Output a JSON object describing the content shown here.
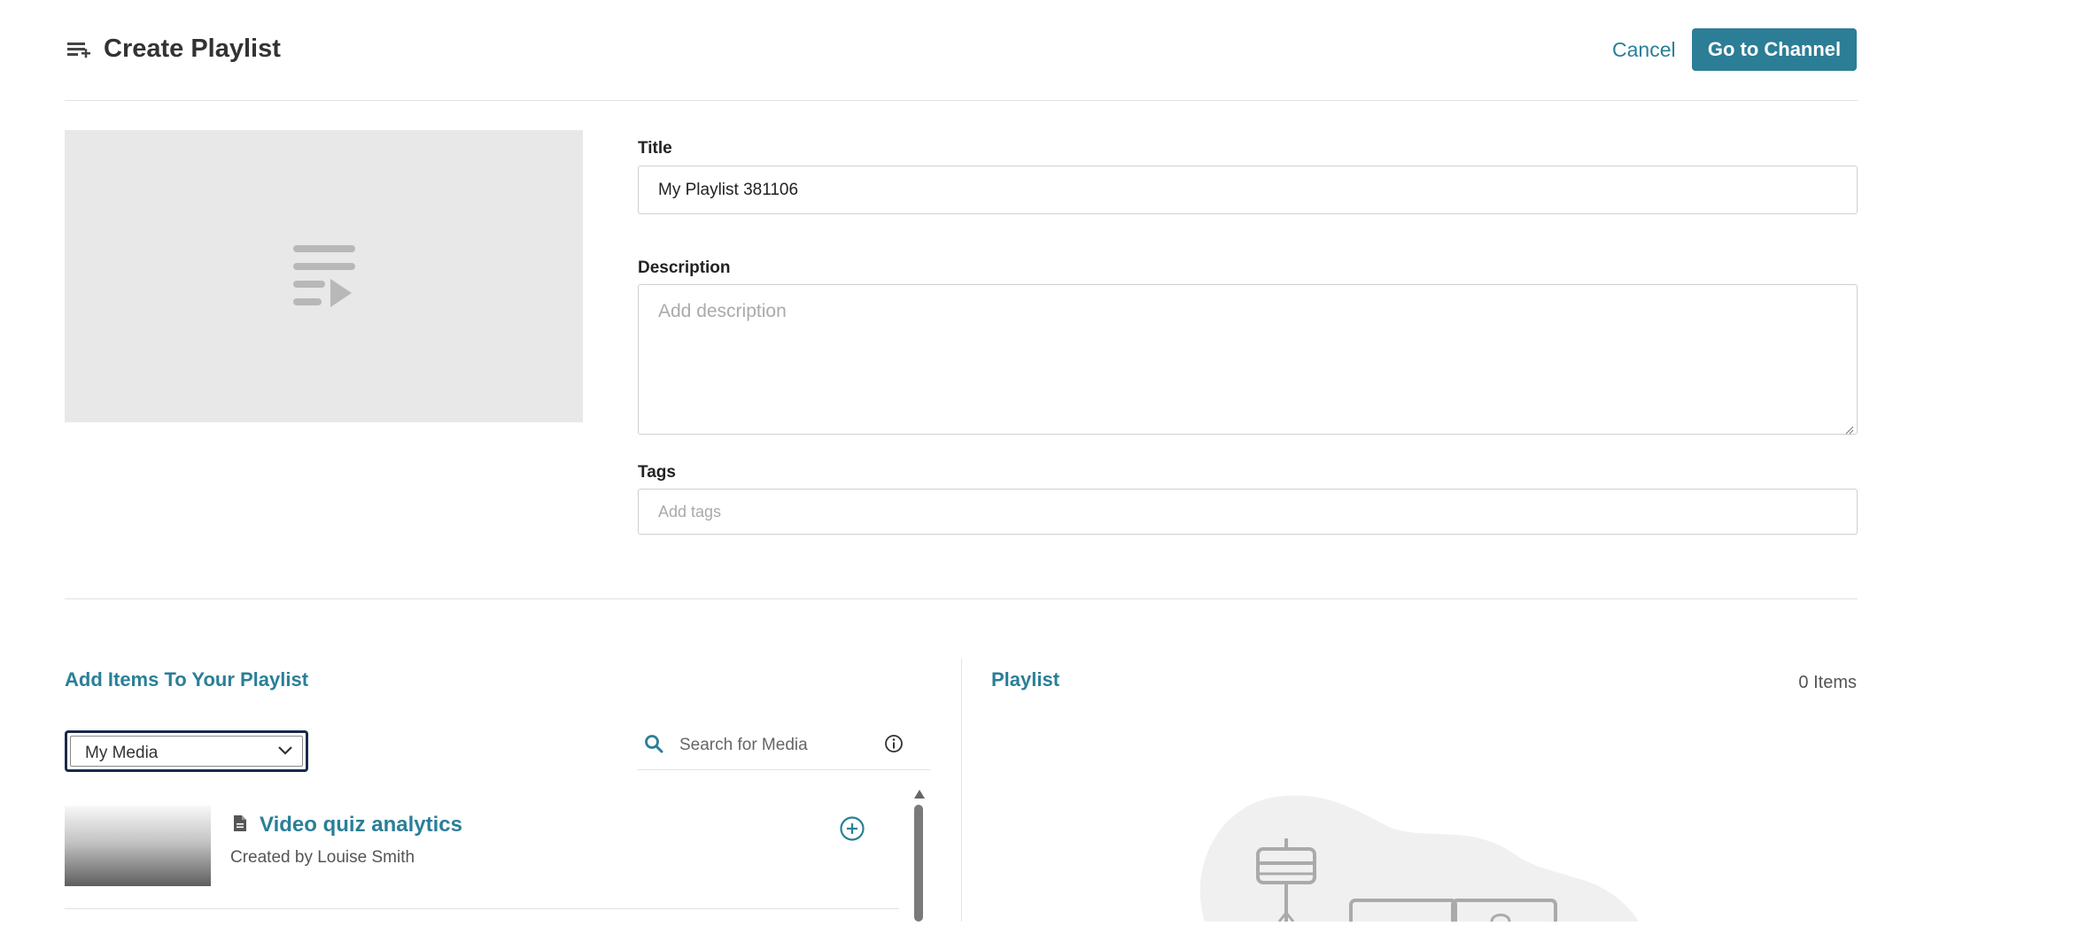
{
  "header": {
    "title": "Create Playlist",
    "cancel_label": "Cancel",
    "go_to_channel_label": "Go to Channel",
    "icon": "playlist-menu-icon"
  },
  "thumbnail": {
    "icon": "playlist-play-icon"
  },
  "form": {
    "title_label": "Title",
    "title_value": "My Playlist 381106",
    "description_label": "Description",
    "description_placeholder": "Add description",
    "tags_label": "Tags",
    "tags_placeholder": "Add tags"
  },
  "add_items": {
    "heading": "Add Items To Your Playlist",
    "source_select": {
      "selected": "My Media",
      "options": [
        "My Media"
      ]
    },
    "search_placeholder": "Search for Media",
    "media": [
      {
        "title": "Video quiz analytics",
        "subtitle": "Created by Louise Smith",
        "type_icon": "document-icon"
      }
    ]
  },
  "playlist": {
    "heading": "Playlist",
    "count_label": "0 Items"
  },
  "colors": {
    "accent": "#2a7f98",
    "button_bg": "#2c7d96",
    "divider": "#e2e2e2",
    "thumb_bg": "#e8e8e8"
  }
}
